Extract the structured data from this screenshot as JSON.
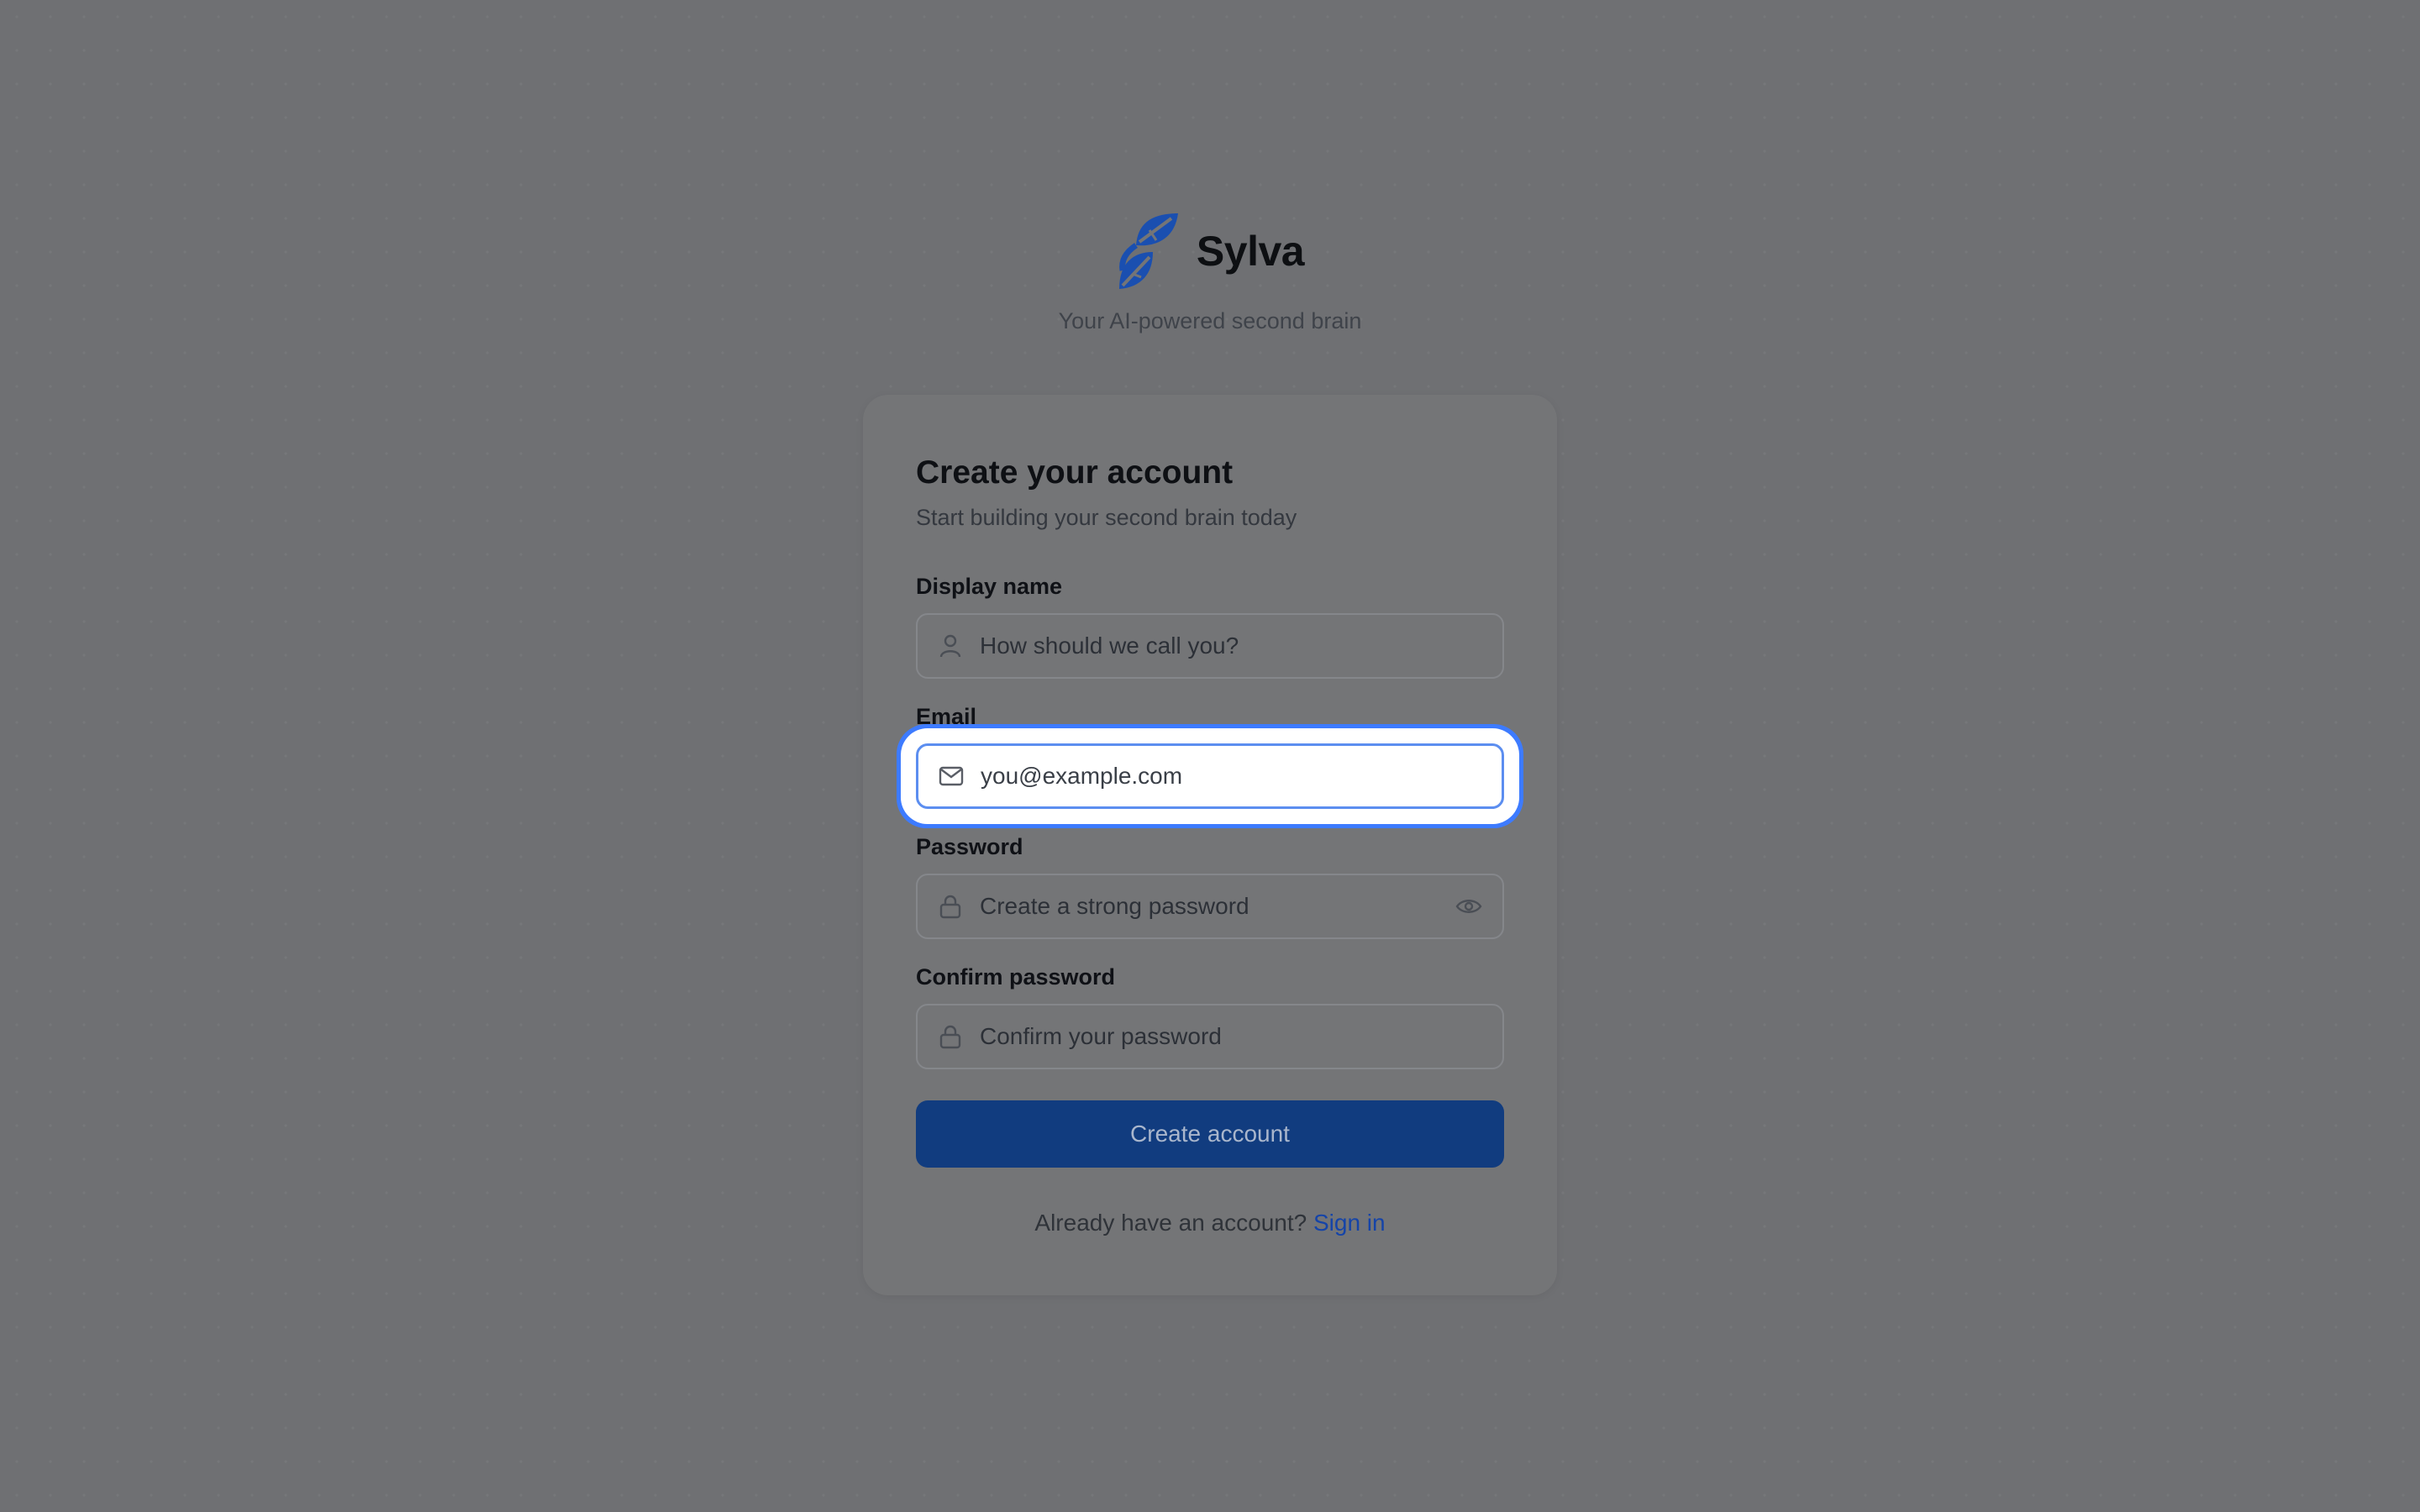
{
  "brand": {
    "name": "Sylva",
    "tagline": "Your AI-powered second brain"
  },
  "card": {
    "title": "Create your account",
    "subtitle": "Start building your second brain today"
  },
  "fields": {
    "display_name": {
      "label": "Display name",
      "placeholder": "How should we call you?"
    },
    "email": {
      "label": "Email",
      "placeholder": "you@example.com"
    },
    "password": {
      "label": "Password",
      "placeholder": "Create a strong password"
    },
    "confirm_password": {
      "label": "Confirm password",
      "placeholder": "Confirm your password"
    }
  },
  "submit_label": "Create account",
  "footer": {
    "prompt": "Already have an account?",
    "link": "Sign in"
  },
  "colors": {
    "brand_blue": "#1a4fb0",
    "focus_ring": "#3d7bff",
    "button": "#113c7f",
    "link": "#1544a8"
  }
}
